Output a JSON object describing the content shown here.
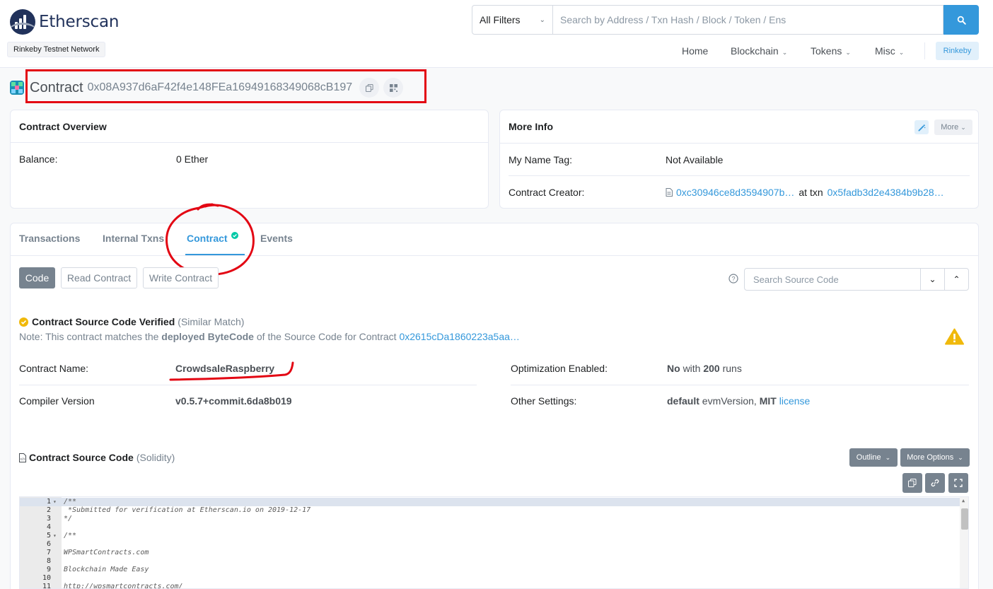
{
  "header": {
    "brand": "Etherscan",
    "network_badge": "Rinkeby Testnet Network",
    "filter_label": "All Filters",
    "search_placeholder": "Search by Address / Txn Hash / Block / Token / Ens",
    "nav": [
      "Home",
      "Blockchain",
      "Tokens",
      "Misc"
    ],
    "network_button": "Rinkeby"
  },
  "title": {
    "label": "Contract",
    "address": "0x08A937d6aF42f4e148FEa16949168349068cB197"
  },
  "overview": {
    "heading": "Contract Overview",
    "balance_label": "Balance:",
    "balance_value": "0 Ether"
  },
  "more_info": {
    "heading": "More Info",
    "more_button": "More",
    "name_tag_label": "My Name Tag:",
    "name_tag_value": "Not Available",
    "creator_label": "Contract Creator:",
    "creator_address": "0xc30946ce8d3594907b…",
    "at_txn": "at txn",
    "creator_txn": "0x5fadb3d2e4384b9b28…"
  },
  "tabs": [
    "Transactions",
    "Internal Txns",
    "Contract",
    "Events"
  ],
  "code_tabs": [
    "Code",
    "Read Contract",
    "Write Contract"
  ],
  "source_search_placeholder": "Search Source Code",
  "verification": {
    "title": "Contract Source Code Verified",
    "match": "(Similar Match)",
    "note_prefix": "Note: This contract matches the",
    "note_bold": "deployed ByteCode",
    "note_suffix": "of the Source Code for Contract",
    "note_link": "0x2615cDa1860223a5aa…"
  },
  "details": {
    "name_label": "Contract Name:",
    "name_value": "CrowdsaleRaspberry",
    "compiler_label": "Compiler Version",
    "compiler_value": "v0.5.7+commit.6da8b019",
    "optimization_label": "Optimization Enabled:",
    "optimization_no": "No",
    "optimization_with": "with",
    "optimization_runs": "200",
    "optimization_runs_word": "runs",
    "other_label": "Other Settings:",
    "other_default": "default",
    "other_evm": "evmVersion,",
    "other_mit": "MIT",
    "other_license": "license"
  },
  "source_code": {
    "heading": "Contract Source Code",
    "language": "(Solidity)",
    "outline_button": "Outline",
    "more_options_button": "More Options",
    "lines": [
      {
        "n": "1",
        "text": "/**",
        "fold": true
      },
      {
        "n": "2",
        "text": " *Submitted for verification at Etherscan.io on 2019-12-17",
        "fold": false
      },
      {
        "n": "3",
        "text": "*/",
        "fold": false
      },
      {
        "n": "4",
        "text": "",
        "fold": false
      },
      {
        "n": "5",
        "text": "/**",
        "fold": true
      },
      {
        "n": "6",
        "text": "",
        "fold": false
      },
      {
        "n": "7",
        "text": "WPSmartContracts.com",
        "fold": false
      },
      {
        "n": "8",
        "text": "",
        "fold": false
      },
      {
        "n": "9",
        "text": "Blockchain Made Easy",
        "fold": false
      },
      {
        "n": "10",
        "text": "",
        "fold": false
      },
      {
        "n": "11",
        "text": "http://wpsmartcontracts.com/",
        "fold": false
      }
    ]
  },
  "colors": {
    "link": "#3498db",
    "annotation_red": "#e30613",
    "verified_gold": "#f0b90b",
    "brand_navy": "#21325b"
  }
}
